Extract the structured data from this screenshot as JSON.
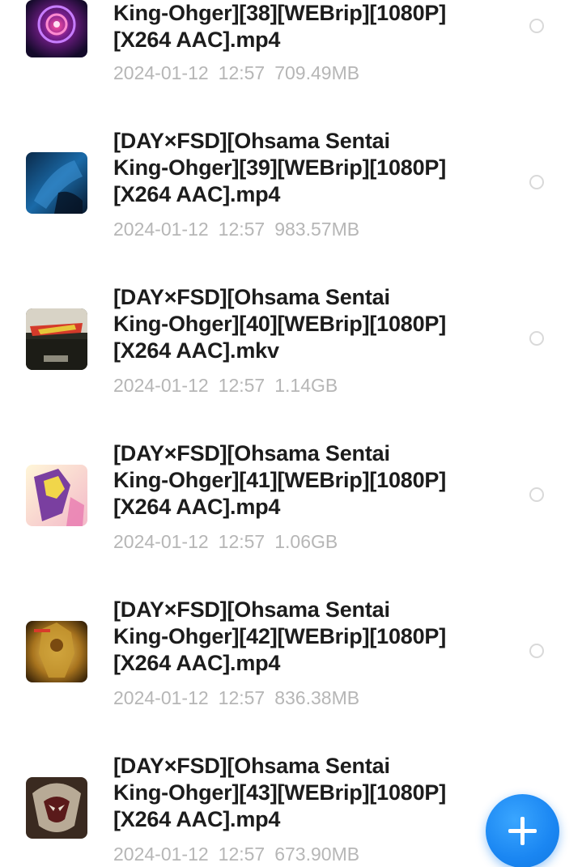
{
  "files": [
    {
      "name": "King-Ohger][38][WEBrip][1080P]\n[X264 AAC].mp4",
      "date": "2024-01-12",
      "time": "12:57",
      "size": "709.49MB",
      "thumb_icon": "video-thumbnail-icon"
    },
    {
      "name": "[DAY×FSD][Ohsama Sentai\nKing-Ohger][39][WEBrip][1080P]\n[X264 AAC].mp4",
      "date": "2024-01-12",
      "time": "12:57",
      "size": "983.57MB",
      "thumb_icon": "video-thumbnail-icon"
    },
    {
      "name": "[DAY×FSD][Ohsama Sentai\nKing-Ohger][40][WEBrip][1080P]\n[X264 AAC].mkv",
      "date": "2024-01-12",
      "time": "12:57",
      "size": "1.14GB",
      "thumb_icon": "video-thumbnail-icon"
    },
    {
      "name": "[DAY×FSD][Ohsama Sentai\nKing-Ohger][41][WEBrip][1080P]\n[X264 AAC].mp4",
      "date": "2024-01-12",
      "time": "12:57",
      "size": "1.06GB",
      "thumb_icon": "video-thumbnail-icon"
    },
    {
      "name": "[DAY×FSD][Ohsama Sentai\nKing-Ohger][42][WEBrip][1080P]\n[X264 AAC].mp4",
      "date": "2024-01-12",
      "time": "12:57",
      "size": "836.38MB",
      "thumb_icon": "video-thumbnail-icon"
    },
    {
      "name": "[DAY×FSD][Ohsama Sentai\nKing-Ohger][43][WEBrip][1080P]\n[X264 AAC].mp4",
      "date": "2024-01-12",
      "time": "12:57",
      "size": "673.90MB",
      "thumb_icon": "video-thumbnail-icon"
    }
  ],
  "fab": {
    "icon": "plus-icon",
    "color": "#1a86f2"
  },
  "colors": {
    "title": "#1c1c1c",
    "meta": "#b6b6b6",
    "radio_border": "#d9d9d9"
  }
}
